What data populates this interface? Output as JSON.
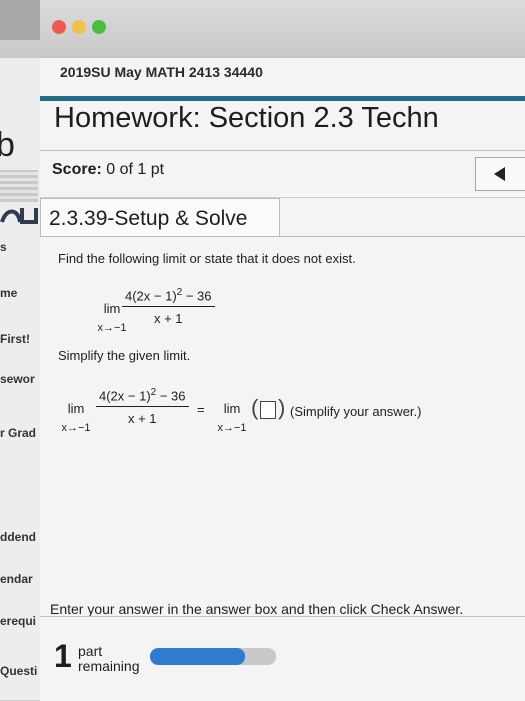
{
  "course": {
    "title": "2019SU May MATH 2413 34440"
  },
  "sidebar": {
    "items": [
      "s",
      "me",
      "First!",
      "sewor",
      "r Grad",
      "ddend",
      "endar",
      "erequi",
      "Questi"
    ]
  },
  "homework": {
    "title": "Homework: Section 2.3 Techn"
  },
  "score": {
    "label": "Score:",
    "value": "0 of 1 pt"
  },
  "question": {
    "tab_label": "2.3.39-Setup & Solve"
  },
  "problem": {
    "prompt": "Find the following limit or state that it does not exist.",
    "lim": "lim",
    "approach": "x→−1",
    "numerator_base": "4(2x − 1)",
    "numerator_exp": "2",
    "numerator_tail": " − 36",
    "denominator": "x + 1",
    "step_prompt": "Simplify the given limit.",
    "equals": "=",
    "hint": "(Simplify your answer.)"
  },
  "footer": {
    "instruction": "Enter your answer in the answer box and then click Check Answer.",
    "parts_count": "1",
    "parts_label_1": "part",
    "parts_label_2": "remaining",
    "progress_fraction": 0.75
  }
}
